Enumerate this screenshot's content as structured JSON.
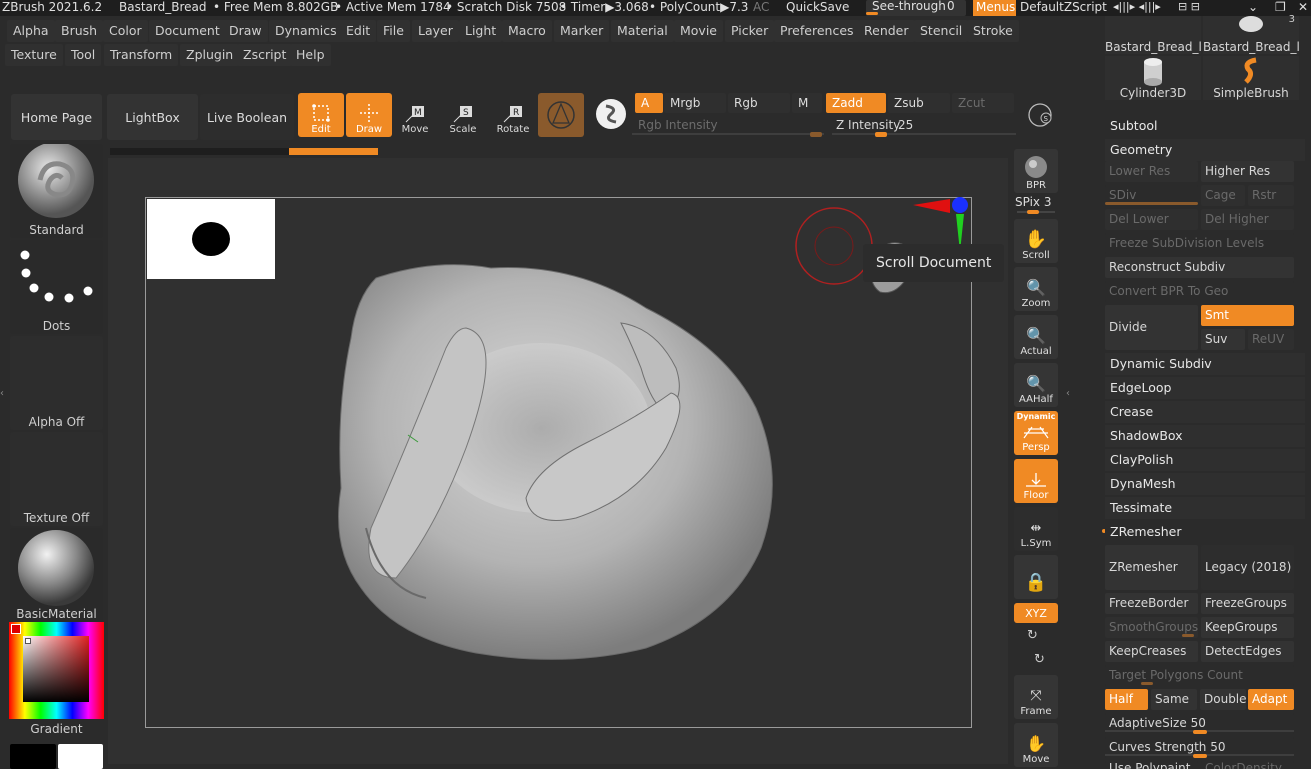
{
  "titlebar": {
    "app": "ZBrush 2021.6.2",
    "doc": "Bastard_Bread",
    "free_mem": "• Free Mem 8.802GB",
    "active_mem": "• Active Mem 1784",
    "scratch": "• Scratch Disk 7508",
    "timer": "• Timer▶3.068",
    "polycount": "• PolyCount▶7.3",
    "ac": "AC",
    "quicksave": "QuickSave",
    "seethrough": "See-through",
    "seethrough_val": "0",
    "menus": "Menus",
    "zscript": "DefaultZScript"
  },
  "menus_row1": [
    "Alpha",
    "Brush",
    "Color",
    "Document",
    "Draw",
    "Dynamics",
    "Edit",
    "File",
    "Layer",
    "Light",
    "Macro",
    "Marker",
    "Material",
    "Movie",
    "Picker",
    "Preferences",
    "Render",
    "Stencil",
    "Stroke"
  ],
  "menus_row2": [
    "Texture",
    "Tool",
    "Transform",
    "Zplugin",
    "Zscript",
    "Help"
  ],
  "toolbar": {
    "home": "Home Page",
    "lightbox": "LightBox",
    "liveboolean": "Live Boolean",
    "edit": "Edit",
    "draw": "Draw",
    "move": "Move",
    "scale": "Scale",
    "rotate": "Rotate",
    "a": "A",
    "mrgb": "Mrgb",
    "rgb": "Rgb",
    "m": "M",
    "zadd": "Zadd",
    "zsub": "Zsub",
    "zcut": "Zcut",
    "rgb_intensity": "Rgb Intensity",
    "z_intensity_label": "Z Intensity",
    "z_intensity_val": "25",
    "z_intensity_level": 0.25
  },
  "leftshelf": {
    "brush": "Standard",
    "stroke": "Dots",
    "alpha": "Alpha Off",
    "texture": "Texture Off",
    "material": "BasicMaterial",
    "gradient": "Gradient"
  },
  "canvas": {
    "tooltip": "Scroll Document"
  },
  "rtools": {
    "bpr": "BPR",
    "spix_label": "SPix",
    "spix_val": "3",
    "scroll": "Scroll",
    "zoom": "Zoom",
    "actual": "Actual",
    "aahalf": "AAHalf",
    "dynamic": "Dynamic",
    "persp": "Persp",
    "floor": "Floor",
    "lsym": "L.Sym",
    "xyz": "XYZ",
    "frame": "Frame",
    "move": "Move"
  },
  "rpanel": {
    "tool1": "Bastard_Bread_l",
    "tool2": "Bastard_Bread_l",
    "tool2_count": "3",
    "tool3": "Cylinder3D",
    "tool4": "SimpleBrush",
    "subtool": "Subtool",
    "geometry": "Geometry",
    "lower_res": "Lower Res",
    "higher_res": "Higher Res",
    "sdiv": "SDiv",
    "cage": "Cage",
    "rstr": "Rstr",
    "del_lower": "Del Lower",
    "del_higher": "Del Higher",
    "freeze_subdiv": "Freeze SubDivision Levels",
    "reconstruct": "Reconstruct Subdiv",
    "convert_bpr": "Convert BPR To Geo",
    "divide": "Divide",
    "smt": "Smt",
    "suv": "Suv",
    "reuv": "ReUV",
    "dynamic_subdiv": "Dynamic Subdiv",
    "edgeloop": "EdgeLoop",
    "crease": "Crease",
    "shadowbox": "ShadowBox",
    "claypolish": "ClayPolish",
    "dynamesh": "DynaMesh",
    "tessimate": "Tessimate",
    "zremesher_head": "ZRemesher",
    "zremesher_btn": "ZRemesher",
    "legacy": "Legacy (2018)",
    "freezeborder": "FreezeBorder",
    "freezegroups": "FreezeGroups",
    "smoothgroups": "SmoothGroups",
    "keepgroups": "KeepGroups",
    "keepcreases": "KeepCreases",
    "detectedges": "DetectEdges",
    "target_poly": "Target Polygons Count",
    "half": "Half",
    "same": "Same",
    "double": "Double",
    "adapt": "Adapt",
    "adaptivesize_label": "AdaptiveSize",
    "adaptivesize_val": "50",
    "adaptivesize_level": 0.5,
    "curves_label": "Curves Strength",
    "curves_val": "50",
    "curves_level": 0.5,
    "use_polypaint": "Use Polypaint",
    "color_density": "ColorDensity"
  }
}
